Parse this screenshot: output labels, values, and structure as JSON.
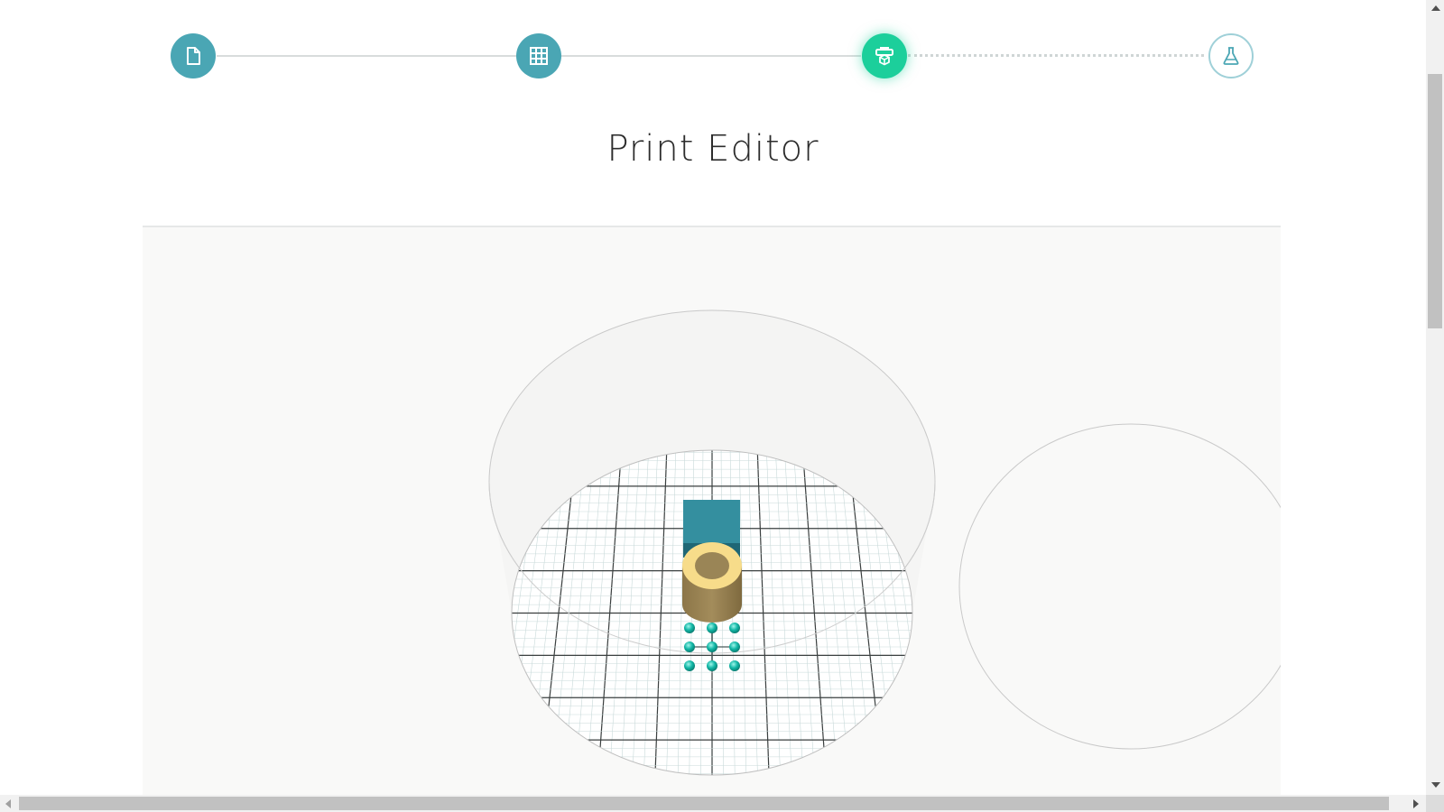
{
  "page": {
    "title": "Print Editor"
  },
  "stepper": {
    "steps": [
      {
        "icon": "file-icon",
        "state": "completed"
      },
      {
        "icon": "grid-icon",
        "state": "completed"
      },
      {
        "icon": "printer-cube-icon",
        "state": "active"
      },
      {
        "icon": "flask-icon",
        "state": "upcoming"
      }
    ]
  },
  "colors": {
    "completed_step": "#4aa6b4",
    "active_step": "#1ccf9b",
    "upcoming_step_border": "#9fd0d8",
    "cube_model": "#348f9f",
    "cylinder_top": "#f7dc8a",
    "cylinder_side": "#9a8556",
    "gizmo_handles": "#12b7a6"
  },
  "viewport": {
    "objects": [
      "cube-model",
      "hollow-cylinder-model"
    ],
    "gizmo_handle_count": 9
  }
}
